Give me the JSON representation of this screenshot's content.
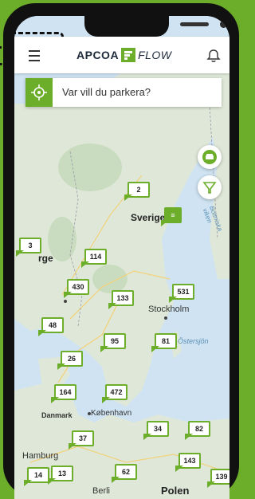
{
  "header": {
    "brand_left": "APCOA",
    "brand_right": "FLOW"
  },
  "search": {
    "placeholder": "Var vill du parkera?"
  },
  "map": {
    "country_sweden": "Sverige",
    "country_norway_partial": "rge",
    "country_poland": "Polen",
    "city_stockholm": "Stockholm",
    "city_kobenhavn": "København",
    "city_hamburg": "Hamburg",
    "city_berlin_partial": "Berli",
    "sea_ostersjon": "Östersjön",
    "sea_bottniska": "Bottniska viken",
    "country_denmark": "Danmark"
  },
  "pins": [
    {
      "label": "2"
    },
    {
      "label": "3"
    },
    {
      "label": "114"
    },
    {
      "label": "430"
    },
    {
      "label": "133"
    },
    {
      "label": "531"
    },
    {
      "label": "48"
    },
    {
      "label": "95"
    },
    {
      "label": "81"
    },
    {
      "label": "26"
    },
    {
      "label": "164"
    },
    {
      "label": "472"
    },
    {
      "label": "34"
    },
    {
      "label": "82"
    },
    {
      "label": "37"
    },
    {
      "label": "143"
    },
    {
      "label": "14"
    },
    {
      "label": "13"
    },
    {
      "label": "62"
    },
    {
      "label": "139"
    }
  ],
  "colors": {
    "accent": "#6cad2a",
    "map_water": "#cfe3f2",
    "map_land": "#dfe8d8"
  },
  "icons": [
    "menu-icon",
    "apcoa-flow-logo-icon",
    "bell-icon",
    "location-target-icon",
    "car-icon",
    "filter-icon"
  ]
}
